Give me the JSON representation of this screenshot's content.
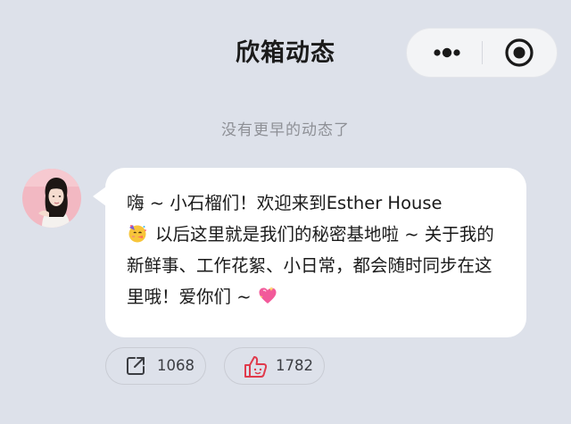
{
  "header": {
    "title": "欣箱动态",
    "capsule": {
      "more_icon": "more-dots-icon",
      "close_icon": "target-close-icon"
    }
  },
  "feed": {
    "earlier_note": "没有更早的动态了",
    "post": {
      "avatar": "avatar-photo",
      "text_part1": "嗨 ~ 小石榴们！欢迎来到Esther House\n",
      "emoji_party": "partying-face-icon",
      "text_part2": "以后这里就是我们的秘密基地啦 ~ 关于我的新鲜事、工作花絮、小日常，都会随时同步在这里哦！爱你们 ~",
      "emoji_heart": "sparkling-heart-icon",
      "share_count": "1068",
      "like_count": "1782"
    }
  },
  "colors": {
    "background": "#dde1ea",
    "bubble": "#ffffff",
    "like_accent": "#e03a4c",
    "title": "#1b1b1b",
    "note": "#8e9096"
  }
}
